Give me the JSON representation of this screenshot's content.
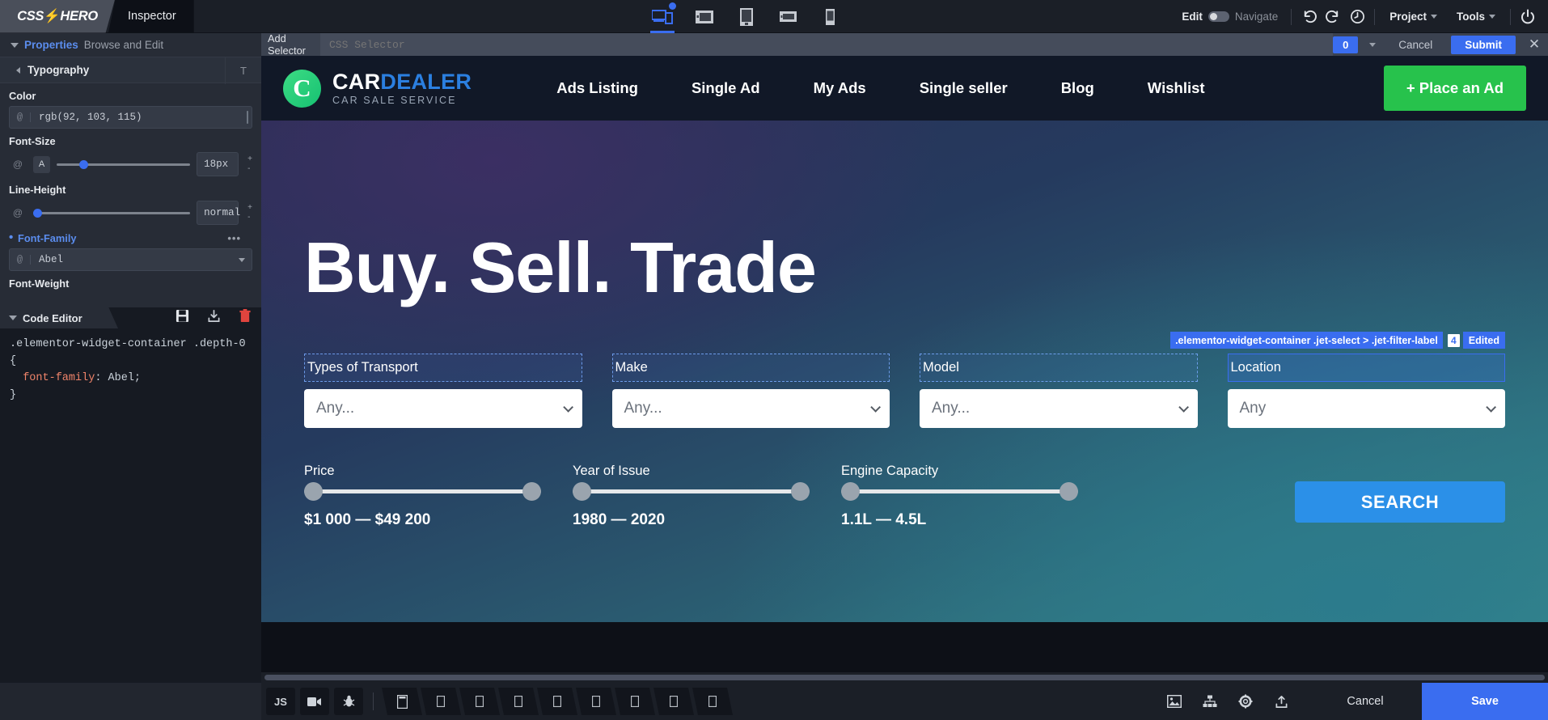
{
  "app": {
    "brand": "CSS HERO",
    "tab_inspector": "Inspector"
  },
  "topbar": {
    "devices": [
      "desktop-responsive",
      "desktop",
      "tablet-portrait",
      "tablet-landscape",
      "mobile"
    ],
    "edit_label": "Edit",
    "navigate_label": "Navigate",
    "undo_icon": "undo-icon",
    "redo_icon": "redo-icon",
    "history_icon": "history-clock-icon",
    "project_label": "Project",
    "tools_label": "Tools",
    "power_icon": "power-icon"
  },
  "sidebar": {
    "properties_title": "Properties",
    "properties_sub": "Browse and Edit",
    "section": {
      "title": "Typography",
      "badge": "T"
    },
    "color": {
      "label": "Color",
      "at": "@",
      "value": "rgb(92, 103, 115)",
      "swatch": "#5c6773"
    },
    "font_size": {
      "label": "Font-Size",
      "at": "@",
      "value": "18px",
      "slider_pct": 17
    },
    "line_height": {
      "label": "Line-Height",
      "at": "@",
      "value": "normal",
      "slider_pct": 0
    },
    "font_family": {
      "label": "Font-Family",
      "at": "@",
      "value": "Abel",
      "dots": "•••"
    },
    "font_weight": {
      "label": "Font-Weight"
    }
  },
  "code_editor": {
    "title": "Code Editor",
    "icons": [
      "save-disk-icon",
      "export-icon",
      "delete-trash-icon"
    ],
    "selector": ".elementor-widget-container .depth-0 {",
    "property": "  font-family",
    "colon": ": ",
    "value": "Abel;",
    "close": "}"
  },
  "selector_bar": {
    "label": "Add Selector",
    "placeholder": "CSS Selector",
    "value": "",
    "count": "0",
    "cancel_label": "Cancel",
    "submit_label": "Submit",
    "close_icon": "close-x-icon"
  },
  "site": {
    "logo": {
      "mark": "C",
      "word1": "CAR",
      "word2": "DEALER",
      "tagline": "CAR SALE SERVICE"
    },
    "nav": [
      "Ads Listing",
      "Single Ad",
      "My Ads",
      "Single seller",
      "Blog",
      "Wishlist"
    ],
    "cta": "+ Place an Ad",
    "hero_title": "Buy. Sell. Trade",
    "filters": [
      {
        "label": "Types of Transport",
        "value": "Any...",
        "selected": false
      },
      {
        "label": "Make",
        "value": "Any...",
        "selected": false
      },
      {
        "label": "Model",
        "value": "Any...",
        "selected": false
      },
      {
        "label": "Location",
        "value": "Any",
        "selected": true
      }
    ],
    "ranges": [
      {
        "label": "Price",
        "value": "$1 000 — $49 200"
      },
      {
        "label": "Year of Issue",
        "value": "1980 — 2020"
      },
      {
        "label": "Engine Capacity",
        "value": "1.1L — 4.5L"
      }
    ],
    "search_label": "SEARCH"
  },
  "overlay_badge": {
    "selector": ".elementor-widget-container .jet-select > .jet-filter-label",
    "count": "4",
    "state": "Edited"
  },
  "bottombar": {
    "left_buttons": [
      "JS",
      "video-camera-icon",
      "bug-icon"
    ],
    "tabs": [
      "device-main",
      "device-2",
      "device-3",
      "device-4",
      "device-5",
      "device-6",
      "device-7",
      "device-8",
      "device-9"
    ],
    "right_icons": [
      "image-icon",
      "sitemap-icon",
      "gear-icon",
      "export-upload-icon"
    ],
    "cancel_label": "Cancel",
    "save_label": "Save"
  },
  "colors": {
    "accent": "#3a6df0",
    "green_cta": "#27c24c",
    "blue_search": "#2b90e8",
    "panel_bg": "#272c36",
    "topbar_bg": "#1b1f27"
  }
}
